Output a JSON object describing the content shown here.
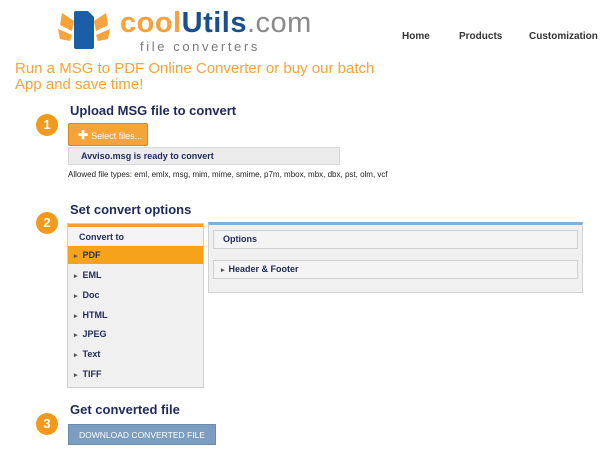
{
  "header": {
    "logo_part1": "cool",
    "logo_part2": "Utils",
    "logo_part3": ".com",
    "logo_subtitle": "file converters",
    "nav": [
      "Home",
      "Products",
      "Customization"
    ]
  },
  "headline": "Run a MSG to PDF Online Converter or buy our batch App and save time!",
  "steps": [
    "1",
    "2",
    "3"
  ],
  "upload": {
    "title": "Upload MSG file to convert",
    "select_label": "Select files...",
    "ready_text": "Avviso.msg is ready to convert",
    "allowed_types": "Allowed file types: eml, emlx, msg, mim, mime, smime, p7m, mbox, mbx, dbx, pst, olm, vcf"
  },
  "options": {
    "title": "Set convert options",
    "convert_to_label": "Convert to",
    "formats": [
      "PDF",
      "EML",
      "Doc",
      "HTML",
      "JPEG",
      "Text",
      "TIFF"
    ],
    "selected": "PDF",
    "options_label": "Options",
    "header_footer_label": "Header & Footer"
  },
  "result": {
    "title": "Get converted file",
    "download_label": "DOWNLOAD CONVERTED FILE"
  },
  "colors": {
    "accent": "#f7a23a",
    "brand_blue": "#1a4f8f",
    "button_blue": "#7b9dbf"
  }
}
